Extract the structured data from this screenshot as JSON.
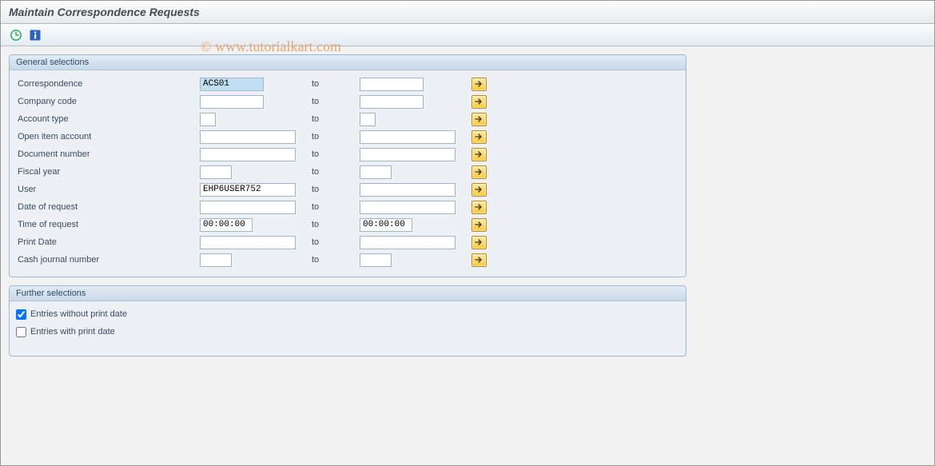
{
  "title": "Maintain Correspondence Requests",
  "watermark": "© www.tutorialkart.com",
  "sections": {
    "general": {
      "header": "General selections",
      "to_label": "to",
      "rows": {
        "correspondence": {
          "label": "Correspondence",
          "from": "ACS01",
          "to": ""
        },
        "company_code": {
          "label": "Company code",
          "from": "",
          "to": ""
        },
        "account_type": {
          "label": "Account type",
          "from": "",
          "to": ""
        },
        "open_item": {
          "label": "Open item account",
          "from": "",
          "to": ""
        },
        "doc_number": {
          "label": "Document number",
          "from": "",
          "to": ""
        },
        "fiscal_year": {
          "label": "Fiscal year",
          "from": "",
          "to": ""
        },
        "user": {
          "label": "User",
          "from": "EHP6USER752",
          "to": ""
        },
        "date_req": {
          "label": "Date of request",
          "from": "",
          "to": ""
        },
        "time_req": {
          "label": "Time of request",
          "from": "00:00:00",
          "to": "00:00:00"
        },
        "print_date": {
          "label": "Print Date",
          "from": "",
          "to": ""
        },
        "cash_journal": {
          "label": "Cash journal number",
          "from": "",
          "to": ""
        }
      }
    },
    "further": {
      "header": "Further selections",
      "entries_without": "Entries without print date",
      "entries_with": "Entries with print date"
    }
  }
}
